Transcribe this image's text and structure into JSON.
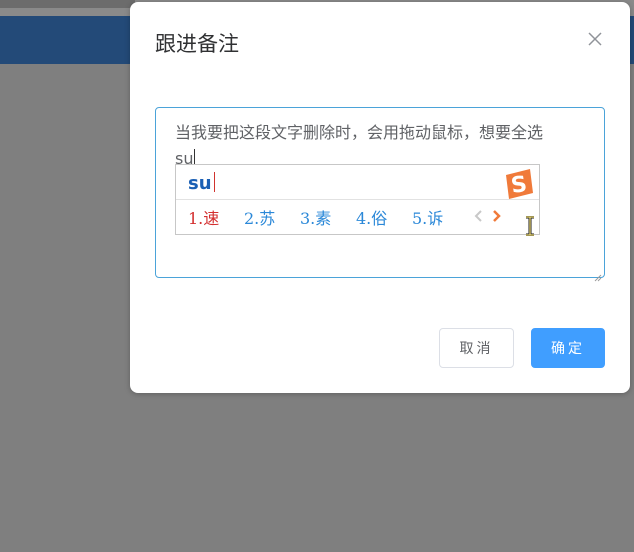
{
  "dialog": {
    "title": "跟进备注",
    "close_icon": "close-icon",
    "textarea_value": "当我要把这段文字删除时，会用拖动鼠标，想要全选",
    "textarea_composing": "su",
    "cancel_label": "取消",
    "ok_label": "确定"
  },
  "ime": {
    "input": "su",
    "logo_icon": "sogou-s-icon",
    "candidates": [
      "1.速",
      "2.苏",
      "3.素",
      "4.俗",
      "5.诉"
    ],
    "prev_icon": "chevron-left-icon",
    "next_icon": "chevron-right-icon"
  },
  "colors": {
    "header": "#234a78",
    "primary": "#409eff",
    "ime_first_candidate": "#d32f2f",
    "ime_candidate": "#2b88d8",
    "ime_input": "#1a5fb4"
  }
}
